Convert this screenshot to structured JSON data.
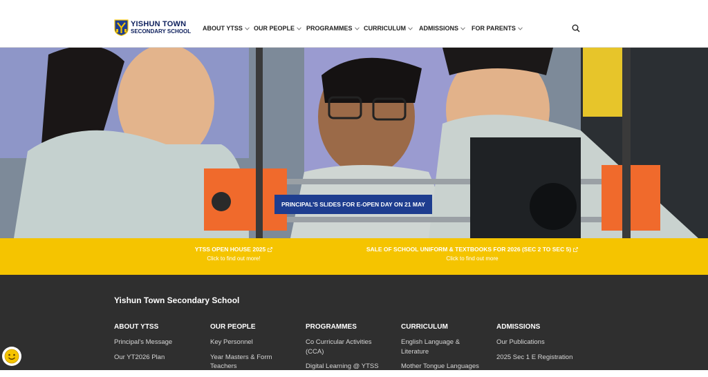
{
  "header": {
    "logo_line1": "YISHUN TOWN",
    "logo_line2": "SECONDARY SCHOOL",
    "nav": [
      {
        "label": "ABOUT YTSS"
      },
      {
        "label": "OUR PEOPLE"
      },
      {
        "label": "PROGRAMMES"
      },
      {
        "label": "CURRICULUM"
      },
      {
        "label": "ADMISSIONS"
      },
      {
        "label": "FOR PARENTS"
      }
    ],
    "search_icon": "search-icon"
  },
  "hero": {
    "cta_label": "PRINCIPAL'S SLIDES FOR E-OPEN DAY ON 21 MAY"
  },
  "band": {
    "items": [
      {
        "title": "YTSS OPEN HOUSE 2025",
        "sub": "Click to find out more!"
      },
      {
        "title": "SALE OF SCHOOL UNIFORM & TEXTBOOKS FOR 2026 (SEC 2 TO SEC 5)",
        "sub": "Click to find out more"
      }
    ]
  },
  "footer": {
    "school_name": "Yishun Town Secondary School",
    "columns": [
      {
        "heading": "ABOUT YTSS",
        "links": [
          "Principal's Message",
          "Our YT2026 Plan"
        ]
      },
      {
        "heading": "OUR PEOPLE",
        "links": [
          "Key Personnel",
          "Year Masters & Form Teachers"
        ]
      },
      {
        "heading": "PROGRAMMES",
        "links": [
          "Co Curricular Activities (CCA)",
          "Digital Learning @ YTSS"
        ]
      },
      {
        "heading": "CURRICULUM",
        "links": [
          "English Language & Literature",
          "Mother Tongue Languages"
        ]
      },
      {
        "heading": "ADMISSIONS",
        "links": [
          "Our Publications",
          "2025 Sec 1 E Registration"
        ]
      }
    ]
  },
  "colors": {
    "brand_navy": "#1e3d8f",
    "band_yellow": "#f5c400",
    "footer_bg": "#2f2f2f"
  }
}
